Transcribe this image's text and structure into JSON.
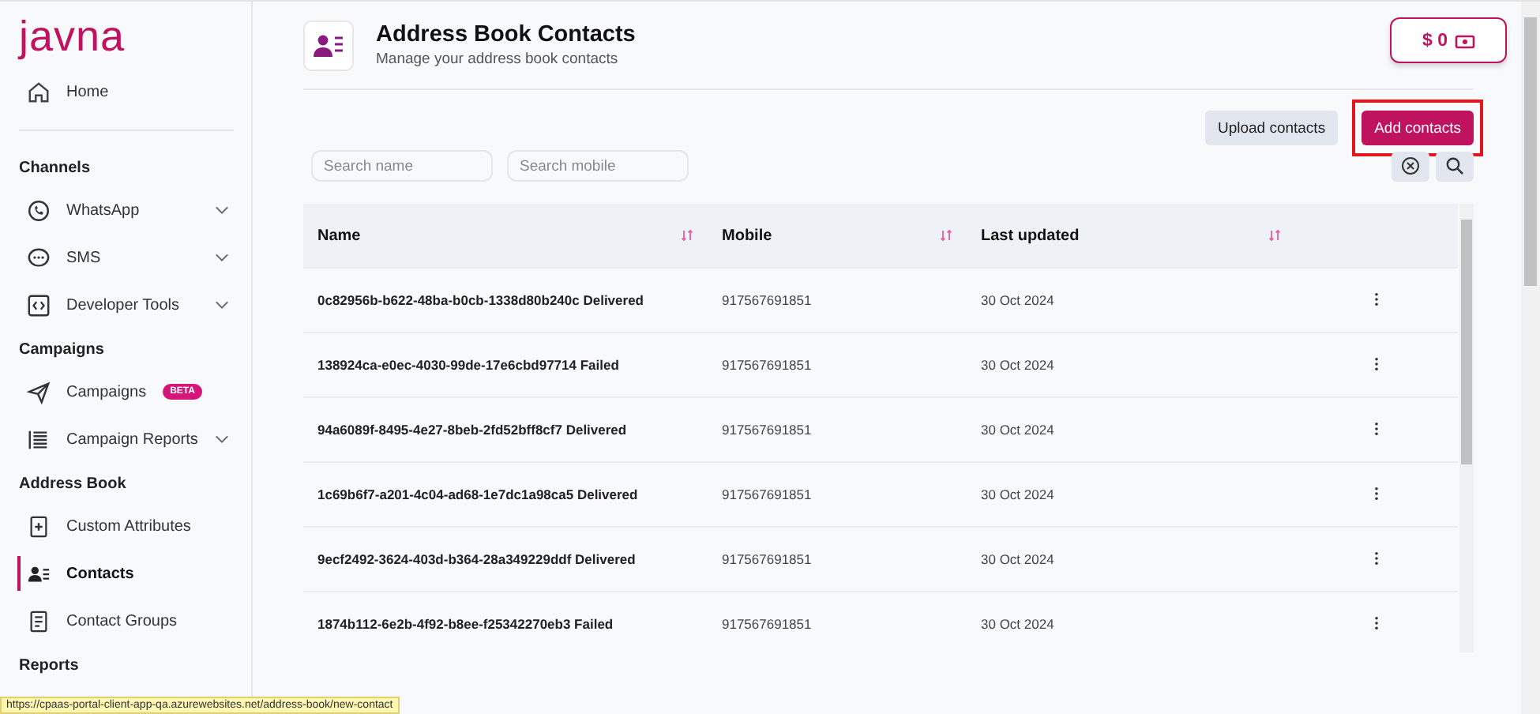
{
  "sidebar": {
    "logo": "javna",
    "home": {
      "label": "Home",
      "selected": false
    },
    "sections": [
      {
        "title": "Channels",
        "items": [
          {
            "label": "WhatsApp",
            "expandable": true,
            "selected": false
          },
          {
            "label": "SMS",
            "expandable": true,
            "selected": false
          },
          {
            "label": "Developer Tools",
            "expandable": true,
            "selected": false
          }
        ]
      },
      {
        "title": "Campaigns",
        "items": [
          {
            "label": "Campaigns",
            "expandable": false,
            "selected": false,
            "badge": "BETA"
          },
          {
            "label": "Campaign Reports",
            "expandable": true,
            "selected": false
          }
        ]
      },
      {
        "title": "Address Book",
        "items": [
          {
            "label": "Custom Attributes",
            "expandable": false,
            "selected": false
          },
          {
            "label": "Contacts",
            "expandable": false,
            "selected": true
          },
          {
            "label": "Contact Groups",
            "expandable": false,
            "selected": false
          }
        ]
      },
      {
        "title": "Reports"
      }
    ]
  },
  "header": {
    "title": "Address Book Contacts",
    "subtitle": "Manage your address book contacts",
    "balance": "$ 0"
  },
  "actions": [
    {
      "label": "Upload contacts",
      "kind": "secondary",
      "highlighted": false
    },
    {
      "label": "Add contacts",
      "kind": "primary",
      "highlighted": true
    }
  ],
  "search": [
    {
      "placeholder": "Search name"
    },
    {
      "placeholder": "Search mobile"
    }
  ],
  "table": {
    "columns": [
      {
        "label": "Name",
        "sortable": true
      },
      {
        "label": "Mobile",
        "sortable": true
      },
      {
        "label": "Last updated",
        "sortable": true
      }
    ],
    "rows": [
      {
        "name": "0c82956b-b622-48ba-b0cb-1338d80b240c Delivered",
        "mobile": "917567691851",
        "updated": "30 Oct 2024"
      },
      {
        "name": "138924ca-e0ec-4030-99de-17e6cbd97714 Failed",
        "mobile": "917567691851",
        "updated": "30 Oct 2024"
      },
      {
        "name": "94a6089f-8495-4e27-8beb-2fd52bff8cf7 Delivered",
        "mobile": "917567691851",
        "updated": "30 Oct 2024"
      },
      {
        "name": "1c69b6f7-a201-4c04-ad68-1e7dc1a98ca5 Delivered",
        "mobile": "917567691851",
        "updated": "30 Oct 2024"
      },
      {
        "name": "9ecf2492-3624-403d-b364-28a349229ddf Delivered",
        "mobile": "917567691851",
        "updated": "30 Oct 2024"
      },
      {
        "name": "1874b112-6e2b-4f92-b8ee-f25342270eb3 Failed",
        "mobile": "917567691851",
        "updated": "30 Oct 2024"
      }
    ]
  },
  "status_bar": {
    "url": "https://cpaas-portal-client-app-qa.azurewebsites.net/address-book/new-contact"
  }
}
